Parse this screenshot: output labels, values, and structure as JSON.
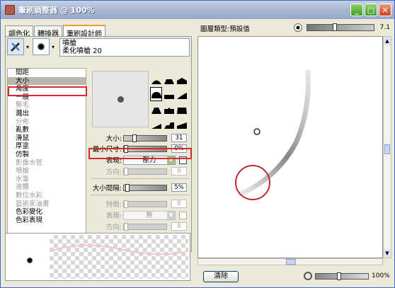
{
  "window": {
    "title": "筆刷調整器 @ 100%"
  },
  "tabs": [
    "調色化",
    "轉換器",
    "筆刷設計師"
  ],
  "brush": {
    "name": "噴槍",
    "variant": "柔化噴槍 20"
  },
  "settings_list": [
    {
      "label": "間距",
      "disabled": false
    },
    {
      "label": "大小",
      "disabled": false,
      "selected": true
    },
    {
      "label": "角度",
      "disabled": false
    },
    {
      "label": "一般",
      "disabled": false
    },
    {
      "label": "鬃毛",
      "disabled": true
    },
    {
      "label": "濺出",
      "disabled": false
    },
    {
      "label": "分佈",
      "disabled": true
    },
    {
      "label": "亂數",
      "disabled": false
    },
    {
      "label": "滑鼠",
      "disabled": false
    },
    {
      "label": "厚塗",
      "disabled": false
    },
    {
      "label": "仿製",
      "disabled": false
    },
    {
      "label": "影像水管",
      "disabled": true
    },
    {
      "label": "噴槍",
      "disabled": true
    },
    {
      "label": "水筆",
      "disabled": true
    },
    {
      "label": "液體",
      "disabled": true
    },
    {
      "label": "數位水彩",
      "disabled": true
    },
    {
      "label": "藝術家油畫",
      "disabled": true
    },
    {
      "label": "色彩變化",
      "disabled": false
    },
    {
      "label": "色彩表現",
      "disabled": false
    }
  ],
  "params": {
    "size": {
      "label": "大小:",
      "value": "31"
    },
    "min_size": {
      "label": "最小尺寸:",
      "value": "0%"
    },
    "expression": {
      "label": "表現:",
      "value": "壓力"
    },
    "direction": {
      "label": "方向:",
      "value": "0"
    },
    "size_step": {
      "label": "大小間隔:",
      "value": "5%"
    },
    "feature": {
      "label": "特徵:",
      "value": "0"
    },
    "expression2": {
      "label": "表現:",
      "value": "無"
    },
    "direction2": {
      "label": "方向:",
      "value": "0"
    }
  },
  "right_panel": {
    "title": "圖層類型:預設值",
    "size_value": "7.1",
    "clear_label": "清除",
    "zoom_value": "100%"
  }
}
